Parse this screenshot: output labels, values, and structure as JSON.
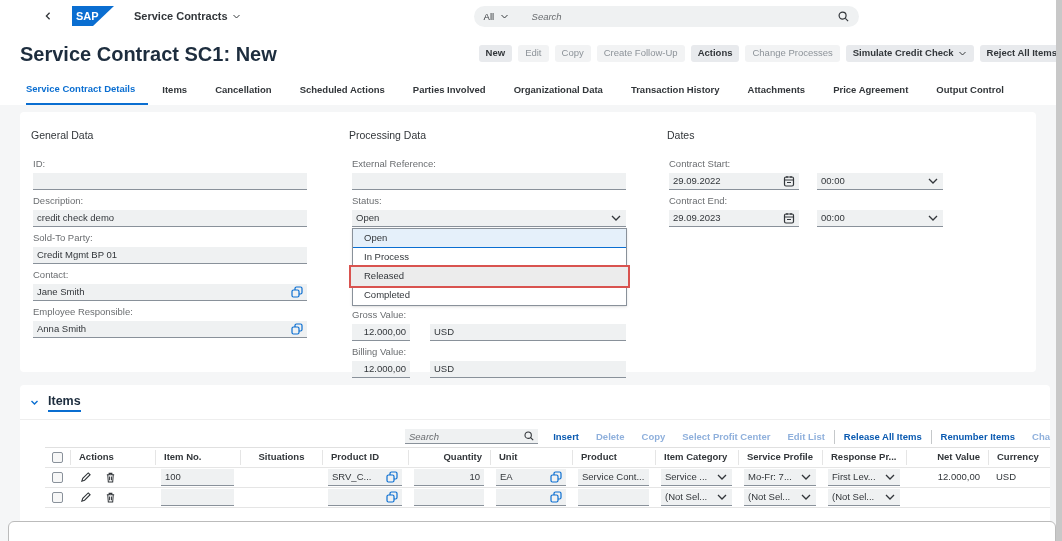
{
  "shell": {
    "app_title": "Service Contracts",
    "logo": "SAP",
    "search": {
      "scope": "All",
      "placeholder": "Search"
    }
  },
  "page": {
    "title": "Service Contract SC1: New",
    "actions": [
      {
        "label": "New",
        "disabled": false,
        "menu": false
      },
      {
        "label": "Edit",
        "disabled": true,
        "menu": false
      },
      {
        "label": "Copy",
        "disabled": true,
        "menu": false
      },
      {
        "label": "Create Follow-Up",
        "disabled": true,
        "menu": false
      },
      {
        "label": "Actions",
        "disabled": false,
        "menu": false
      },
      {
        "label": "Change Processes",
        "disabled": true,
        "menu": false
      },
      {
        "label": "Simulate Credit Check",
        "disabled": false,
        "menu": true
      },
      {
        "label": "Reject All Items",
        "disabled": false,
        "menu": false
      }
    ]
  },
  "tabs": [
    {
      "label": "Service Contract Details",
      "selected": true
    },
    {
      "label": "Items",
      "selected": false
    },
    {
      "label": "Cancellation",
      "selected": false
    },
    {
      "label": "Scheduled Actions",
      "selected": false
    },
    {
      "label": "Parties Involved",
      "selected": false
    },
    {
      "label": "Organizational Data",
      "selected": false
    },
    {
      "label": "Transaction History",
      "selected": false
    },
    {
      "label": "Attachments",
      "selected": false
    },
    {
      "label": "Price Agreement",
      "selected": false
    },
    {
      "label": "Output Control",
      "selected": false
    }
  ],
  "general_data": {
    "title": "General Data",
    "fields": [
      {
        "label": "ID:",
        "kind": "text"
      },
      {
        "label": "Description:",
        "kind": "text",
        "value": "credit check demo"
      },
      {
        "label": "Sold-To Party:",
        "kind": "text",
        "value": "Credit Mgmt BP 01"
      },
      {
        "label": "Contact:",
        "kind": "valuehelp",
        "value": "Jane Smith"
      },
      {
        "label": "Employee Responsible:",
        "kind": "valuehelp",
        "value": "Anna Smith"
      }
    ]
  },
  "processing_data": {
    "title": "Processing Data",
    "fields": [
      {
        "label": "External Reference:",
        "kind": "text"
      },
      {
        "label": "Status:",
        "kind": "select",
        "value": "Open",
        "expanded": true,
        "options": [
          {
            "label": "Open",
            "selected": true,
            "marked": false
          },
          {
            "label": "In Process",
            "selected": false,
            "marked": false
          },
          {
            "label": "Released",
            "selected": false,
            "marked": true
          },
          {
            "label": "Completed",
            "selected": false,
            "marked": false
          }
        ]
      },
      {
        "label": "Gross Value:",
        "kind": "amount",
        "value": "12.000,00",
        "currency": "USD"
      },
      {
        "label": "Billing Value:",
        "kind": "amount",
        "value": "12.000,00",
        "currency": "USD"
      }
    ]
  },
  "dates": {
    "title": "Dates",
    "fields": [
      {
        "label": "Contract Start:",
        "date": "29.09.2022",
        "time": "00:00"
      },
      {
        "label": "Contract End:",
        "date": "29.09.2023",
        "time": "00:00"
      }
    ]
  },
  "items": {
    "title": "Items",
    "expanded": true,
    "search": {
      "placeholder": "Search"
    },
    "toolbar": [
      {
        "label": "Insert",
        "disabled": false,
        "separator_before": false
      },
      {
        "label": "Delete",
        "disabled": true,
        "separator_before": false
      },
      {
        "label": "Copy",
        "disabled": true,
        "separator_before": false
      },
      {
        "label": "Select Profit Center",
        "disabled": true,
        "separator_before": false
      },
      {
        "label": "Edit List",
        "disabled": true,
        "separator_before": false
      },
      {
        "label": "Release All Items",
        "disabled": false,
        "separator_before": true
      },
      {
        "label": "Renumber Items",
        "disabled": false,
        "separator_before": true
      },
      {
        "label": "Cha",
        "disabled": true,
        "separator_before": false
      }
    ],
    "select_all": {
      "checked": false
    },
    "columns": [
      {
        "label": "Actions"
      },
      {
        "label": "Item No."
      },
      {
        "label": "Situations"
      },
      {
        "label": "Product ID"
      },
      {
        "label": "Quantity"
      },
      {
        "label": "Unit"
      },
      {
        "label": "Product"
      },
      {
        "label": "Item Category"
      },
      {
        "label": "Service Profile"
      },
      {
        "label": "Response Pr..."
      },
      {
        "label": "Net Value"
      },
      {
        "label": "Currency"
      }
    ],
    "rows": [
      {
        "checked": false,
        "cells": [
          {
            "kind": "actions"
          },
          {
            "kind": "input",
            "value": "100"
          },
          {
            "kind": "text"
          },
          {
            "kind": "valuehelp",
            "value": "SRV_C..."
          },
          {
            "kind": "input",
            "value": "10"
          },
          {
            "kind": "valuehelp",
            "value": "EA"
          },
          {
            "kind": "input",
            "value": "Service Cont..."
          },
          {
            "kind": "select",
            "value": "Service ..."
          },
          {
            "kind": "select",
            "value": "Mo-Fr: 7..."
          },
          {
            "kind": "select",
            "value": "First Lev..."
          },
          {
            "kind": "text",
            "value": "12.000,00"
          },
          {
            "kind": "text",
            "value": "USD"
          }
        ]
      },
      {
        "checked": false,
        "cells": [
          {
            "kind": "actions"
          },
          {
            "kind": "input"
          },
          {
            "kind": "text"
          },
          {
            "kind": "valuehelp"
          },
          {
            "kind": "input"
          },
          {
            "kind": "valuehelp"
          },
          {
            "kind": "input"
          },
          {
            "kind": "select",
            "value": "(Not Sel..."
          },
          {
            "kind": "select",
            "value": "(Not Sel..."
          },
          {
            "kind": "select",
            "value": "(Not Sel..."
          },
          {
            "kind": "text"
          },
          {
            "kind": "text"
          }
        ]
      }
    ]
  }
}
